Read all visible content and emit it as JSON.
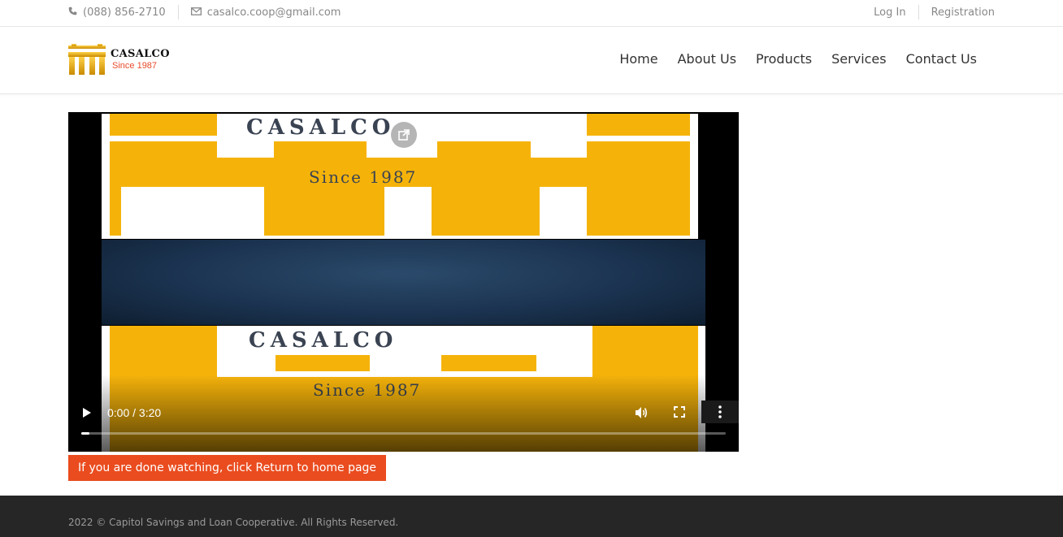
{
  "topbar": {
    "phone": "(088) 856-2710",
    "email": "casalco.coop@gmail.com",
    "login": "Log In",
    "register": "Registration"
  },
  "header": {
    "logo_name": "CASALCO",
    "logo_since": "Since 1987",
    "nav": [
      "Home",
      "About Us",
      "Products",
      "Services",
      "Contact Us"
    ]
  },
  "video": {
    "brand_text": "CASALCO",
    "brand_since": "Since 1987",
    "time_display": "0:00 / 3:20",
    "progress_fraction": 0.0
  },
  "return_button": "If you are done watching, click Return to home page",
  "footer": {
    "copyright": "2022 © Capitol Savings and Loan Cooperative. All Rights Reserved."
  },
  "colors": {
    "accent": "#ea4c1f",
    "brand_yellow": "#f5b30a",
    "footer_bg": "#262626"
  }
}
